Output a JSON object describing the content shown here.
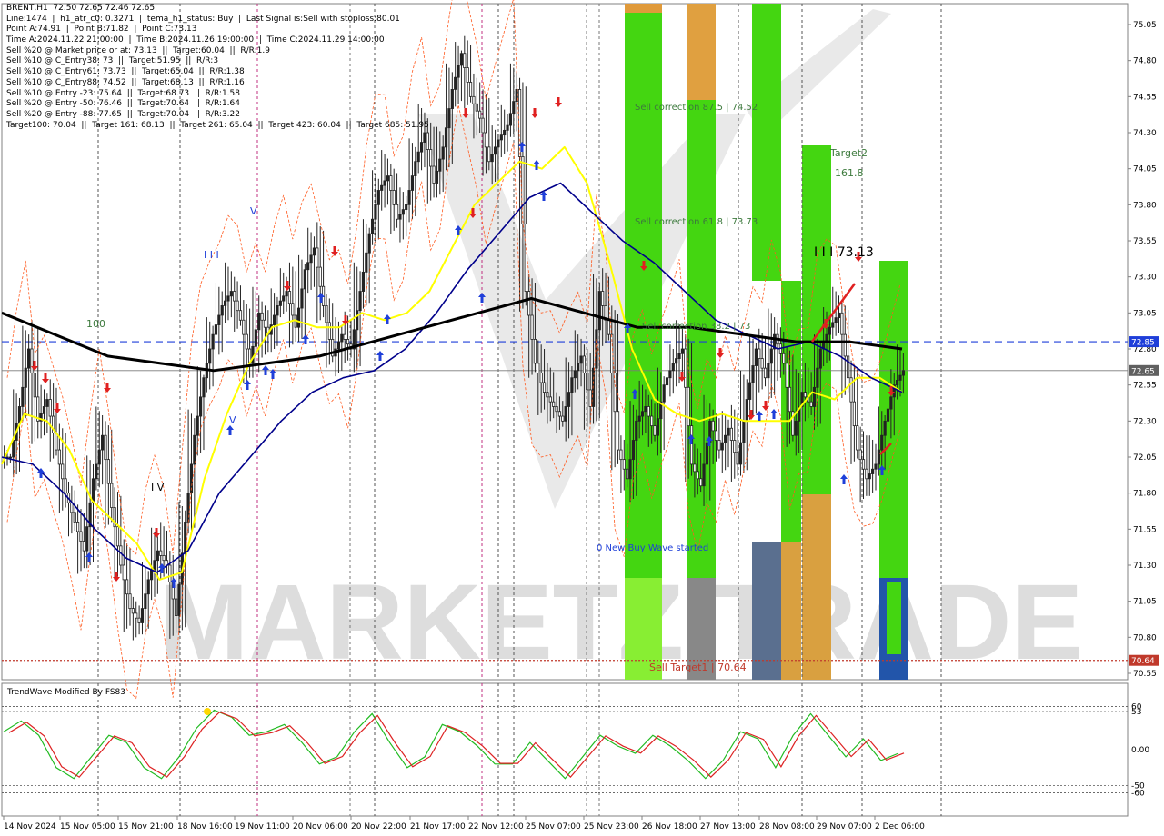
{
  "info_lines": [
    "BRENT,H1  72.50 72.65 72.46 72.65",
    "Line:1474  |  h1_atr_c0: 0.3271  |  tema_h1_status: Buy  |  Last Signal is:Sell with stoploss:80.01",
    "Point A:74.91  |  Point B:71.82  |  Point C:73.13",
    "Time A:2024.11.22 21:00:00  |  Time B:2024.11.26 19:00:00  |  Time C:2024.11.29 14:00:00",
    "Sell %20 @ Market price or at: 73.13  ||  Target:60.04  ||  R/R:1.9",
    "Sell %10 @ C_Entry38: 73  ||  Target:51.95  ||  R/R:3",
    "Sell %10 @ C_Entry61: 73.73  ||  Target:65.04  ||  R/R:1.38",
    "Sell %10 @ C_Entry88: 74.52  ||  Target:68.13  ||  R/R:1.16",
    "Sell %10 @ Entry -23: 75.64  ||  Target:68.73  ||  R/R:1.58",
    "Sell %20 @ Entry -50: 76.46  ||  Target:70.64  ||  R/R:1.64",
    "Sell %20 @ Entry -88: 77.65  ||  Target:70.04  ||  R/R:3.22",
    "Target100: 70.04  ||  Target 161: 68.13  ||  Target 261: 65.04  ||  Target 423: 60.04  ||  Target 685: 51.95"
  ],
  "chart_data": {
    "type": "candlestick",
    "symbol": "BRENT,H1",
    "ohlc_last": [
      72.5,
      72.65,
      72.46,
      72.65
    ],
    "price_axis_ticks": [
      "75.05",
      "74.80",
      "74.55",
      "74.30",
      "74.05",
      "73.80",
      "73.55",
      "73.30",
      "73.05",
      "72.80",
      "72.55",
      "72.30",
      "72.05",
      "71.80",
      "71.55",
      "71.30",
      "71.05",
      "70.80",
      "70.55"
    ],
    "price_tags": [
      {
        "label": "72.85",
        "value": 72.85,
        "color": "#1f3fd9"
      },
      {
        "label": "72.65",
        "value": 72.65,
        "color": "#606060"
      },
      {
        "label": "70.64",
        "value": 70.64,
        "color": "#c0392b"
      }
    ],
    "time_labels": [
      "14 Nov 2024",
      "15 Nov 05:00",
      "15 Nov 21:00",
      "18 Nov 16:00",
      "19 Nov 11:00",
      "20 Nov 06:00",
      "20 Nov 22:00",
      "21 Nov 17:00",
      "22 Nov 12:00",
      "25 Nov 07:00",
      "25 Nov 23:00",
      "26 Nov 18:00",
      "27 Nov 13:00",
      "28 Nov 08:00",
      "29 Nov 07:00",
      "2 Dec 06:00"
    ],
    "close_series": [
      72.05,
      72.4,
      72.8,
      72.3,
      72.45,
      72.1,
      71.8,
      71.6,
      71.4,
      71.9,
      72.2,
      71.7,
      71.3,
      71.0,
      70.9,
      71.2,
      71.4,
      71.3,
      70.95,
      71.6,
      72.2,
      72.6,
      72.9,
      73.1,
      73.2,
      73.0,
      72.7,
      73.05,
      72.9,
      73.1,
      73.2,
      72.95,
      73.35,
      73.5,
      73.1,
      72.75,
      72.9,
      72.8,
      73.2,
      73.6,
      73.9,
      74.0,
      73.7,
      73.8,
      74.1,
      74.3,
      73.95,
      74.2,
      74.6,
      74.85,
      74.55,
      74.4,
      74.1,
      74.25,
      74.35,
      74.6,
      73.2,
      72.7,
      72.5,
      72.4,
      72.3,
      72.6,
      72.75,
      72.4,
      73.2,
      72.9,
      72.1,
      71.9,
      72.3,
      72.4,
      72.2,
      72.55,
      72.7,
      72.8,
      72.0,
      71.85,
      72.3,
      72.1,
      72.25,
      72.0,
      72.45,
      72.8,
      72.6,
      72.9,
      72.7,
      72.2,
      72.5,
      72.4,
      72.8,
      72.95,
      73.05,
      72.6,
      72.1,
      71.9,
      72.0,
      72.3,
      72.55,
      72.65
    ],
    "series": [
      {
        "name": "",
        "type": "ema-fast",
        "color": "#ffff00",
        "values": [
          72.0,
          72.35,
          72.3,
          72.1,
          71.75,
          71.6,
          71.45,
          71.2,
          71.25,
          71.9,
          72.35,
          72.7,
          72.95,
          73.0,
          72.95,
          72.95,
          73.05,
          73.0,
          73.05,
          73.2,
          73.5,
          73.8,
          73.95,
          74.1,
          74.05,
          74.2,
          73.95,
          73.4,
          72.8,
          72.45,
          72.35,
          72.3,
          72.35,
          72.3,
          72.3,
          72.3,
          72.5,
          72.45,
          72.6,
          72.6,
          72.5
        ]
      },
      {
        "name": "",
        "type": "ema-mid",
        "color": "#00008b",
        "values": [
          72.05,
          72.0,
          71.8,
          71.55,
          71.35,
          71.25,
          71.4,
          71.8,
          72.05,
          72.3,
          72.5,
          72.6,
          72.65,
          72.8,
          73.05,
          73.35,
          73.6,
          73.85,
          73.95,
          73.75,
          73.55,
          73.4,
          73.2,
          73.0,
          72.9,
          72.8,
          72.85,
          72.75,
          72.6,
          72.5
        ]
      },
      {
        "name": "",
        "type": "ema-slow",
        "color": "#000000",
        "values": [
          73.05,
          72.9,
          72.75,
          72.7,
          72.65,
          72.7,
          72.75,
          72.85,
          72.95,
          73.05,
          73.15,
          73.05,
          72.95,
          72.95,
          72.9,
          72.85,
          72.85,
          72.8
        ]
      }
    ],
    "annotations": [
      {
        "text": "100",
        "color": "#3d7a3d"
      },
      {
        "text": "I I I",
        "color": "#1f3fd9"
      },
      {
        "text": "V",
        "color": "#1f3fd9"
      },
      {
        "text": "I V",
        "color": "#000000"
      },
      {
        "text": "V",
        "color": "#1f3fd9"
      },
      {
        "text": "Sell correction 87.5 | 74.52",
        "color": "#3d7a3d"
      },
      {
        "text": "Sell correction 61.8 | 73.73",
        "color": "#3d7a3d"
      },
      {
        "text": "Sell correction 38.2 | 73",
        "color": "#3d7a3d"
      },
      {
        "text": "0 New Buy Wave started",
        "color": "#1f3fd9"
      },
      {
        "text": "Sell Target1 | 70.64",
        "color": "#c0392b"
      },
      {
        "text": "Target2",
        "color": "#3d7a3d"
      },
      {
        "text": "161.8",
        "color": "#3d7a3d"
      },
      {
        "text": "I I I 73.13",
        "color": "#000000"
      }
    ],
    "indicator": {
      "title": "TrendWave Modified By FS83",
      "ticks": [
        "60",
        "53",
        "0.00",
        "-50",
        "-60"
      ],
      "green_series": [
        25,
        40,
        20,
        -25,
        -40,
        -10,
        20,
        10,
        -25,
        -40,
        -10,
        30,
        55,
        45,
        20,
        25,
        35,
        10,
        -20,
        -10,
        25,
        50,
        10,
        -25,
        -10,
        35,
        25,
        5,
        -20,
        -20,
        10,
        -15,
        -40,
        -10,
        20,
        5,
        -5,
        20,
        5,
        -15,
        -40,
        -15,
        25,
        15,
        -25,
        20,
        50,
        20,
        -10,
        15,
        -15,
        -5
      ]
    },
    "watermark": "MARKETZITRADE"
  }
}
